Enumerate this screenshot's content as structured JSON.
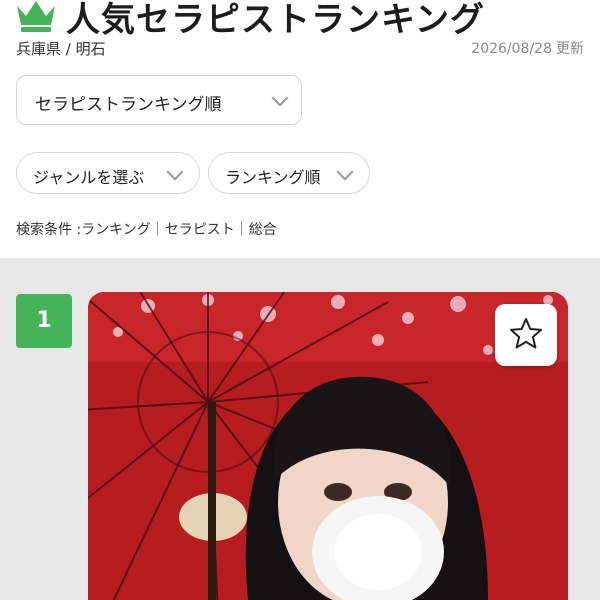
{
  "header": {
    "title": "人気セラピストランキング",
    "crown_icon": "crown-icon",
    "accent_color": "#44b35a",
    "location": "兵庫県 / 明石",
    "updated_date": "2026/08/28",
    "updated_label": "更新"
  },
  "sort_select": {
    "value": "セラピストランキング順",
    "icon": "chevron-down-icon"
  },
  "filters": {
    "genre_label": "ジャンルを選ぶ",
    "order_label": "ランキング順"
  },
  "conditions": {
    "text": "検索条件 :ランキング｜セラピスト｜総合"
  },
  "ranking": {
    "items": [
      {
        "rank": "1",
        "favorite_icon": "star-icon",
        "photo": "therapist-photo"
      }
    ]
  }
}
